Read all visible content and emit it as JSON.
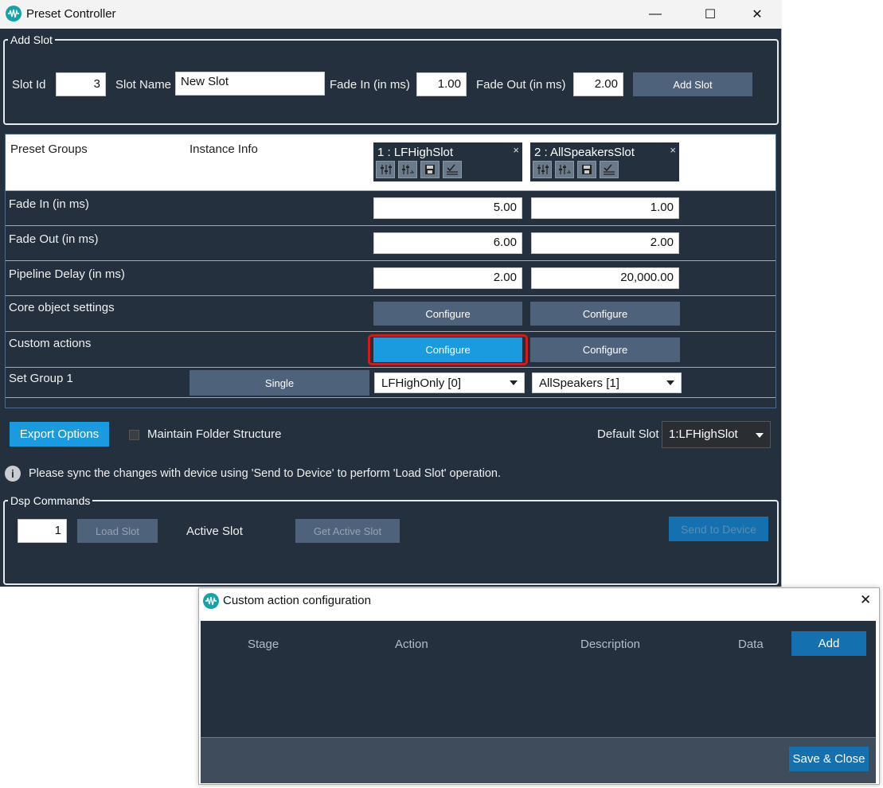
{
  "main_window": {
    "title": "Preset Controller",
    "controls": {
      "minimize": "—",
      "maximize": "☐",
      "close": "✕"
    }
  },
  "add_slot": {
    "group_title": "Add Slot",
    "slot_id_label": "Slot Id",
    "slot_id_value": "3",
    "slot_name_label": "Slot Name",
    "slot_name_value": "New Slot",
    "fade_in_label": "Fade In (in ms)",
    "fade_in_value": "1.00",
    "fade_out_label": "Fade Out (in ms)",
    "fade_out_value": "2.00",
    "add_button": "Add Slot"
  },
  "grid": {
    "headers": {
      "preset_groups": "Preset Groups",
      "instance_info": "Instance Info"
    },
    "slots": [
      {
        "name": "1 : LFHighSlot",
        "close": "×"
      },
      {
        "name": "2 : AllSpeakersSlot",
        "close": "×"
      }
    ],
    "rows": {
      "fade_in": {
        "label": "Fade In (in ms)",
        "values": [
          "5.00",
          "1.00"
        ]
      },
      "fade_out": {
        "label": "Fade Out (in ms)",
        "values": [
          "6.00",
          "2.00"
        ]
      },
      "pipeline_delay": {
        "label": "Pipeline Delay (in ms)",
        "values": [
          "2.00",
          "20,000.00"
        ]
      },
      "core_object": {
        "label": "Core object settings",
        "buttons": [
          "Configure",
          "Configure"
        ]
      },
      "custom_actions": {
        "label": "Custom actions",
        "buttons": [
          "Configure",
          "Configure"
        ]
      },
      "set_group": {
        "label": "Set Group 1",
        "mode_button": "Single",
        "selections": [
          "LFHighOnly [0]",
          "AllSpeakers [1]"
        ]
      }
    }
  },
  "export": {
    "button": "Export Options",
    "maintain_label": "Maintain Folder Structure",
    "maintain_checked": false,
    "default_slot_label": "Default Slot",
    "default_slot_value": "1:LFHighSlot"
  },
  "info_message": "Please sync the changes with device using 'Send to Device' to perform 'Load Slot' operation.",
  "dsp_commands": {
    "group_title": "Dsp Commands",
    "slot_value": "1",
    "load_button": "Load Slot",
    "active_slot_label": "Active Slot",
    "get_active_button": "Get Active Slot",
    "send_button": "Send to Device"
  },
  "dialog": {
    "title": "Custom action configuration",
    "close": "✕",
    "columns": [
      "Stage",
      "Action",
      "Description",
      "Data"
    ],
    "add_button": "Add",
    "save_button": "Save & Close"
  },
  "colors": {
    "background": "#24303e",
    "accent": "#1a9be0",
    "button": "#4e637b",
    "highlight_border": "#d21c1c"
  }
}
